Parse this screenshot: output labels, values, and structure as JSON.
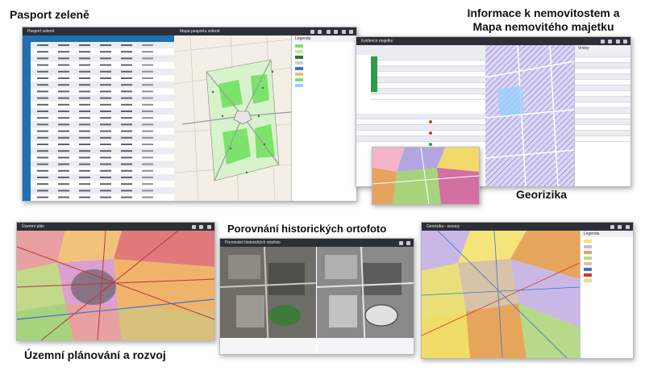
{
  "captions": {
    "pasport": "Pasport zeleně",
    "nemovitosti_line1": "Informace k nemovitostem a",
    "nemovitosti_line2": "Mapa nemovitého majetku",
    "porovnani": "Porovnání historických ortofoto",
    "georizika": "Georizika",
    "uzemni": "Územní plánování a rozvoj"
  },
  "screens": {
    "pasport": {
      "panel_title": "Pasport zeleně",
      "map_title": "Mapa pasportu zeleně",
      "legend_title": "Legenda"
    },
    "nemovitosti": {
      "panel_title": "Evidence majetku",
      "legend_title": "Vrstvy"
    },
    "uzemni": {
      "app_title": "Územní plán"
    },
    "porovnani": {
      "app_title": "Porovnání historických ortofoto"
    },
    "georizika": {
      "app_title": "Georizika - sesuvy",
      "legend_title": "Legenda"
    }
  },
  "colors": {
    "toolbar": "#2c2f36",
    "accent_blue": "#1f6fb2",
    "green_area": "#7be36b",
    "map_bg": "#f3efe6"
  },
  "icons": [
    "toolbar-tool-icon",
    "map-pin-icon",
    "layers-icon"
  ]
}
